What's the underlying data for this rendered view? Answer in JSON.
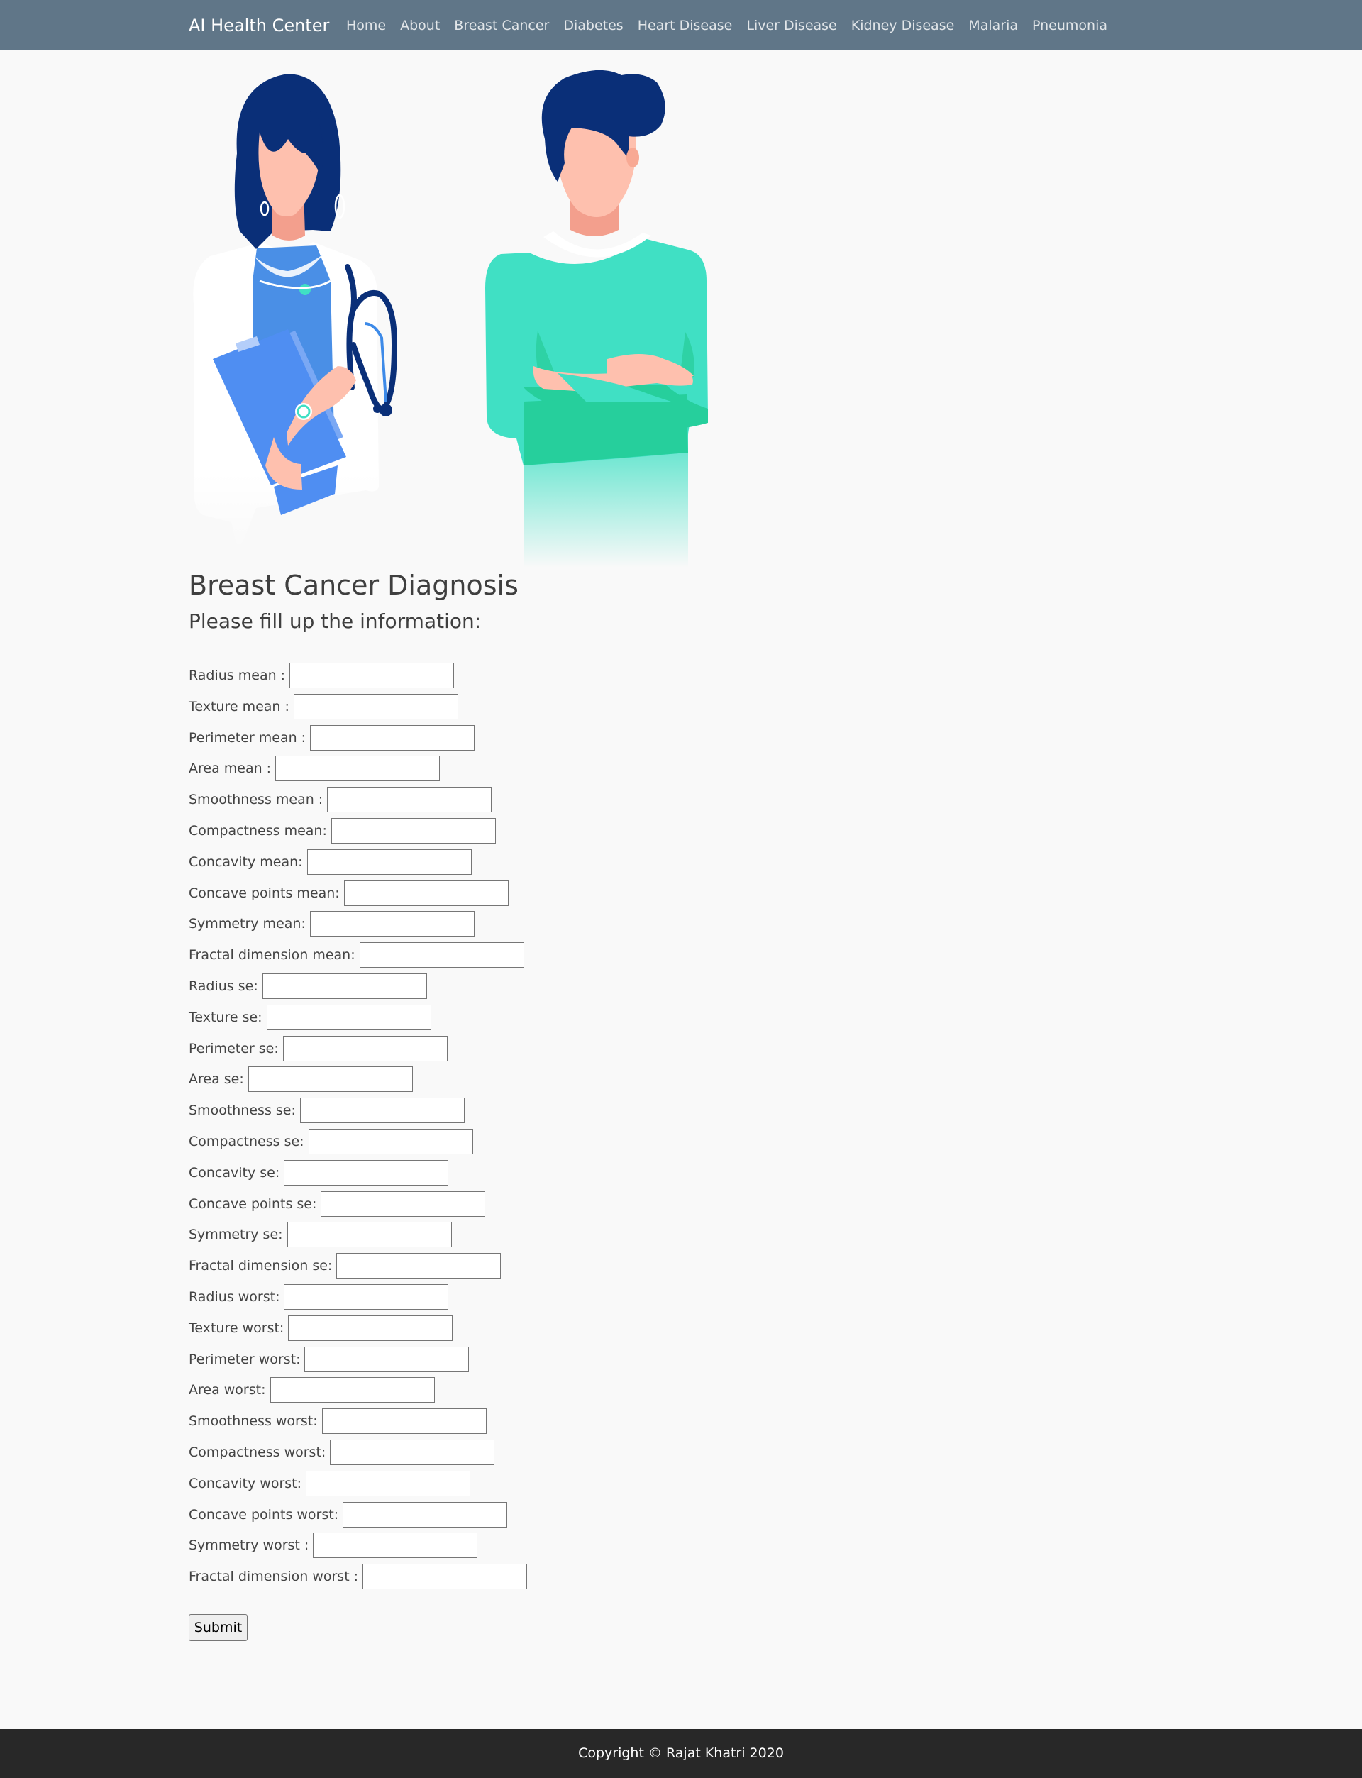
{
  "navbar": {
    "brand": "AI Health Center",
    "links": [
      "Home",
      "About",
      "Breast Cancer",
      "Diabetes",
      "Heart Disease",
      "Liver Disease",
      "Kidney Disease",
      "Malaria",
      "Pneumonia"
    ]
  },
  "page": {
    "title": "Breast Cancer Diagnosis",
    "subtitle": "Please fill up the information:"
  },
  "form": {
    "fields": [
      "Radius mean :",
      "Texture mean :",
      "Perimeter mean :",
      "Area mean :",
      "Smoothness mean :",
      "Compactness mean:",
      "Concavity mean:",
      "Concave points mean:",
      "Symmetry mean:",
      "Fractal dimension mean:",
      "Radius se:",
      "Texture se:",
      "Perimeter se:",
      "Area se:",
      "Smoothness se:",
      "Compactness se:",
      "Concavity se:",
      "Concave points se:",
      "Symmetry se:",
      "Fractal dimension se:",
      "Radius worst:",
      "Texture worst:",
      "Perimeter worst:",
      "Area worst:",
      "Smoothness worst:",
      "Compactness worst:",
      "Concavity worst:",
      "Concave points worst:",
      "Symmetry worst :",
      "Fractal dimension worst :"
    ],
    "submit_label": "Submit"
  },
  "footer": {
    "text": "Copyright © Rajat Khatri 2020"
  },
  "colors": {
    "navbar": "#607688",
    "footer": "#282828",
    "background": "#f9f9f9",
    "scrubs": "#40e0c4",
    "hair": "#0a2f78",
    "skin": "#fec0ae",
    "clipboard": "#4f8ef2"
  }
}
